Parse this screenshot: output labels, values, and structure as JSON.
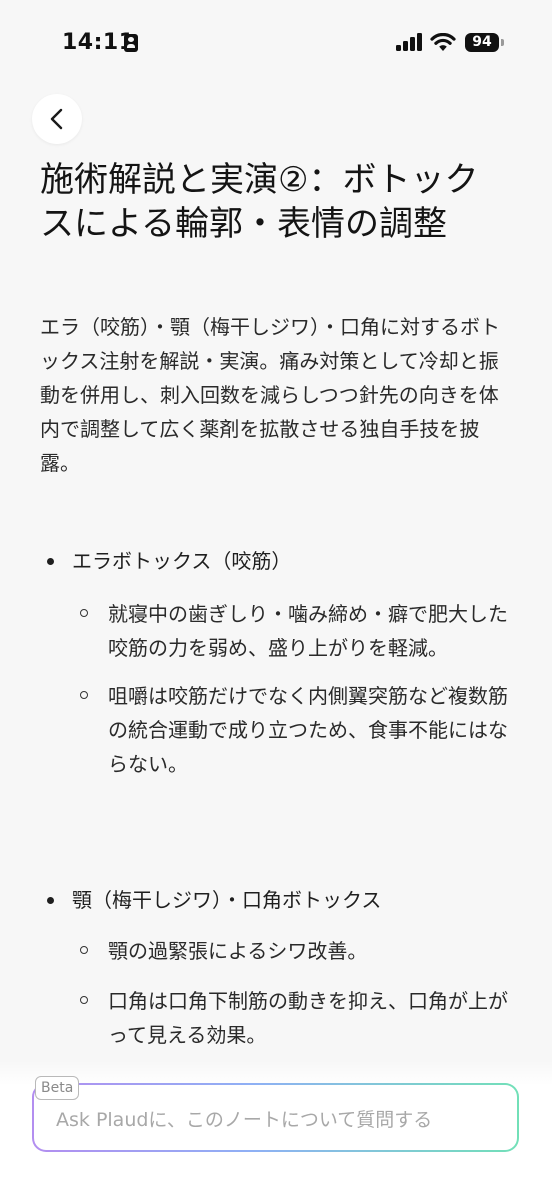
{
  "status_bar": {
    "time": "14:11",
    "battery": "94"
  },
  "icons": {
    "back": "chevron-left-icon",
    "signal": "cellular-signal-icon",
    "wifi": "wifi-icon",
    "battery": "battery-icon",
    "focus": "person-focus-icon"
  },
  "page": {
    "title": "施術解説と実演②：ボトックスによる輪郭・表情の調整",
    "summary": "エラ（咬筋）・顎（梅干しジワ）・口角に対するボトックス注射を解説・実演。痛み対策として冷却と振動を併用し、刺入回数を減らしつつ針先の向きを体内で調整して広く薬剤を拡散させる独自手技を披露。"
  },
  "sections": [
    {
      "heading": "エラボトックス（咬筋）",
      "points": [
        "就寝中の歯ぎしり・噛み締め・癖で肥大した咬筋の力を弱め、盛り上がりを軽減。",
        "咀嚼は咬筋だけでなく内側翼突筋など複数筋の統合運動で成り立つため、食事不能にはならない。"
      ]
    },
    {
      "heading": "顎（梅干しジワ）・口角ボトックス",
      "points": [
        "顎の過緊張によるシワ改善。",
        "口角は口角下制筋の動きを抑え、口角が上がって見える効果。"
      ]
    }
  ],
  "ask": {
    "badge": "Beta",
    "placeholder": "Ask Plaudに、このノートについて質問する"
  },
  "colors": {
    "background": "#f7f7f7",
    "text": "#1b1b1b",
    "gradient_start": "#b38ef0",
    "gradient_end": "#72e0b8"
  }
}
